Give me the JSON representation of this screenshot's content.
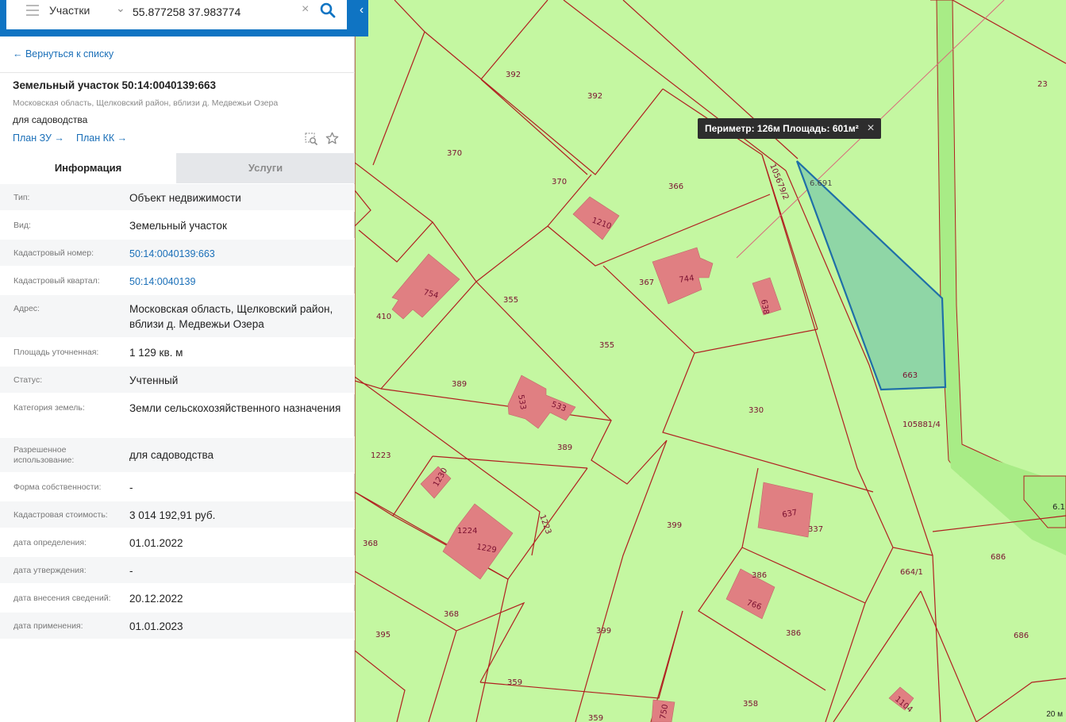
{
  "search": {
    "layer": "Участки",
    "query": "55.877258 37.983774"
  },
  "back_link": "← Вернуться к списку",
  "parcel": {
    "title": "Земельный участок 50:14:0040139:663",
    "address": "Московская область, Щелковский район, вблизи д. Медвежьи Озера",
    "use": "для садоводства",
    "plan_zu": "План ЗУ →",
    "plan_kk": "План КК →"
  },
  "tabs": {
    "info": "Информация",
    "services": "Услуги"
  },
  "properties": [
    {
      "label": "Тип:",
      "value": "Объект недвижимости"
    },
    {
      "label": "Вид:",
      "value": "Земельный участок"
    },
    {
      "label": "Кадастровый номер:",
      "value": "50:14:0040139:663"
    },
    {
      "label": "Кадастровый квартал:",
      "value": "50:14:0040139"
    },
    {
      "label": "Адрес:",
      "value": "Московская область, Щелковский район, вблизи д. Медвежьи Озера"
    },
    {
      "label": "Площадь уточненная:",
      "value": "1 129 кв. м"
    },
    {
      "label": "Статус:",
      "value": "Учтенный"
    },
    {
      "label": "Категория земель:",
      "value": "Земли сельскохозяйственного назначения"
    },
    {
      "label": "Разрешенное использование:",
      "value": "для садоводства"
    },
    {
      "label": "Форма собственности:",
      "value": "-"
    },
    {
      "label": "Кадастровая стоимость:",
      "value": "3 014 192,91 руб."
    },
    {
      "label": "дата определения:",
      "value": "01.01.2022"
    },
    {
      "label": "дата утверждения:",
      "value": "-"
    },
    {
      "label": "дата внесения сведений:",
      "value": "20.12.2022"
    },
    {
      "label": "дата применения:",
      "value": "01.01.2023"
    }
  ],
  "map": {
    "tooltip": "Периметр: 126м Площадь: 601м²",
    "scale": "20 м",
    "parcel_labels": [
      "392",
      "392",
      "23",
      "370",
      "370",
      "366",
      "105679/2",
      "6.691",
      "1210",
      "367",
      "744",
      "638",
      "754",
      "410",
      "355",
      "355",
      "663",
      "389",
      "533",
      "533",
      "330",
      "105881/4",
      "389",
      "1223",
      "1230",
      "1223",
      "399",
      "637",
      "337",
      "6.1",
      "368",
      "1224",
      "1229",
      "664/1",
      "686",
      "386",
      "766",
      "368",
      "395",
      "399",
      "386",
      "686",
      "359",
      "359",
      "750",
      "358",
      "1104"
    ],
    "colors": {
      "land": "#c4f7a1",
      "road": "#a8ec86",
      "border": "#b02020",
      "building": "#e07f82",
      "selected_fill": "#8fd6a6",
      "selected_stroke": "#1f6fa8"
    }
  }
}
